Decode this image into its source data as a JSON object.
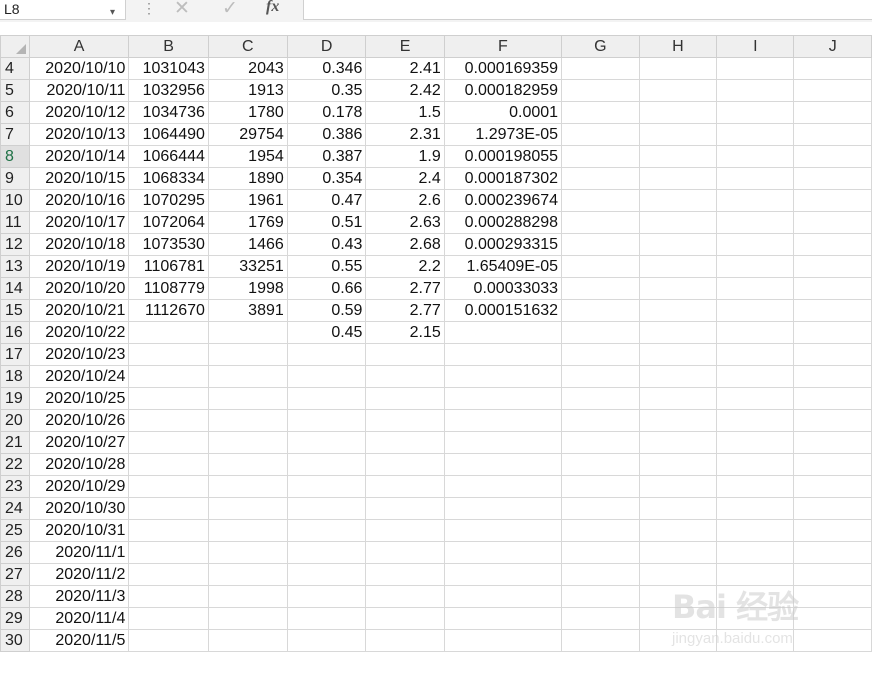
{
  "formula_bar": {
    "name_box": "L8",
    "name_box_arrow": "▾",
    "dots": "⋮",
    "cancel_icon": "✕",
    "enter_icon": "✓",
    "fx_label": "fx",
    "formula": ""
  },
  "columns": [
    "A",
    "B",
    "C",
    "D",
    "E",
    "F",
    "G",
    "H",
    "I",
    "J"
  ],
  "active_row": "8",
  "rows": [
    {
      "n": "4",
      "A": "2020/10/10",
      "B": "1031043",
      "C": "2043",
      "D": "0.346",
      "E": "2.41",
      "F": "0.000169359"
    },
    {
      "n": "5",
      "A": "2020/10/11",
      "B": "1032956",
      "C": "1913",
      "D": "0.35",
      "E": "2.42",
      "F": "0.000182959"
    },
    {
      "n": "6",
      "A": "2020/10/12",
      "B": "1034736",
      "C": "1780",
      "D": "0.178",
      "E": "1.5",
      "F": "0.0001"
    },
    {
      "n": "7",
      "A": "2020/10/13",
      "B": "1064490",
      "C": "29754",
      "D": "0.386",
      "E": "2.31",
      "F": "1.2973E-05"
    },
    {
      "n": "8",
      "A": "2020/10/14",
      "B": "1066444",
      "C": "1954",
      "D": "0.387",
      "E": "1.9",
      "F": "0.000198055"
    },
    {
      "n": "9",
      "A": "2020/10/15",
      "B": "1068334",
      "C": "1890",
      "D": "0.354",
      "E": "2.4",
      "F": "0.000187302"
    },
    {
      "n": "10",
      "A": "2020/10/16",
      "B": "1070295",
      "C": "1961",
      "D": "0.47",
      "E": "2.6",
      "F": "0.000239674"
    },
    {
      "n": "11",
      "A": "2020/10/17",
      "B": "1072064",
      "C": "1769",
      "D": "0.51",
      "E": "2.63",
      "F": "0.000288298"
    },
    {
      "n": "12",
      "A": "2020/10/18",
      "B": "1073530",
      "C": "1466",
      "D": "0.43",
      "E": "2.68",
      "F": "0.000293315"
    },
    {
      "n": "13",
      "A": "2020/10/19",
      "B": "1106781",
      "C": "33251",
      "D": "0.55",
      "E": "2.2",
      "F": "1.65409E-05"
    },
    {
      "n": "14",
      "A": "2020/10/20",
      "B": "1108779",
      "C": "1998",
      "D": "0.66",
      "E": "2.77",
      "F": "0.00033033"
    },
    {
      "n": "15",
      "A": "2020/10/21",
      "B": "1112670",
      "C": "3891",
      "D": "0.59",
      "E": "2.77",
      "F": "0.000151632"
    },
    {
      "n": "16",
      "A": "2020/10/22",
      "B": "",
      "C": "",
      "D": "0.45",
      "E": "2.15",
      "F": ""
    },
    {
      "n": "17",
      "A": "2020/10/23",
      "B": "",
      "C": "",
      "D": "",
      "E": "",
      "F": ""
    },
    {
      "n": "18",
      "A": "2020/10/24",
      "B": "",
      "C": "",
      "D": "",
      "E": "",
      "F": ""
    },
    {
      "n": "19",
      "A": "2020/10/25",
      "B": "",
      "C": "",
      "D": "",
      "E": "",
      "F": ""
    },
    {
      "n": "20",
      "A": "2020/10/26",
      "B": "",
      "C": "",
      "D": "",
      "E": "",
      "F": ""
    },
    {
      "n": "21",
      "A": "2020/10/27",
      "B": "",
      "C": "",
      "D": "",
      "E": "",
      "F": ""
    },
    {
      "n": "22",
      "A": "2020/10/28",
      "B": "",
      "C": "",
      "D": "",
      "E": "",
      "F": ""
    },
    {
      "n": "23",
      "A": "2020/10/29",
      "B": "",
      "C": "",
      "D": "",
      "E": "",
      "F": ""
    },
    {
      "n": "24",
      "A": "2020/10/30",
      "B": "",
      "C": "",
      "D": "",
      "E": "",
      "F": ""
    },
    {
      "n": "25",
      "A": "2020/10/31",
      "B": "",
      "C": "",
      "D": "",
      "E": "",
      "F": ""
    },
    {
      "n": "26",
      "A": "2020/11/1",
      "B": "",
      "C": "",
      "D": "",
      "E": "",
      "F": ""
    },
    {
      "n": "27",
      "A": "2020/11/2",
      "B": "",
      "C": "",
      "D": "",
      "E": "",
      "F": ""
    },
    {
      "n": "28",
      "A": "2020/11/3",
      "B": "",
      "C": "",
      "D": "",
      "E": "",
      "F": ""
    },
    {
      "n": "29",
      "A": "2020/11/4",
      "B": "",
      "C": "",
      "D": "",
      "E": "",
      "F": ""
    },
    {
      "n": "30",
      "A": "2020/11/5",
      "B": "",
      "C": "",
      "D": "",
      "E": "",
      "F": ""
    }
  ],
  "watermark": {
    "logo": "Bai 经验",
    "sub": "jingyan.baidu.com"
  }
}
